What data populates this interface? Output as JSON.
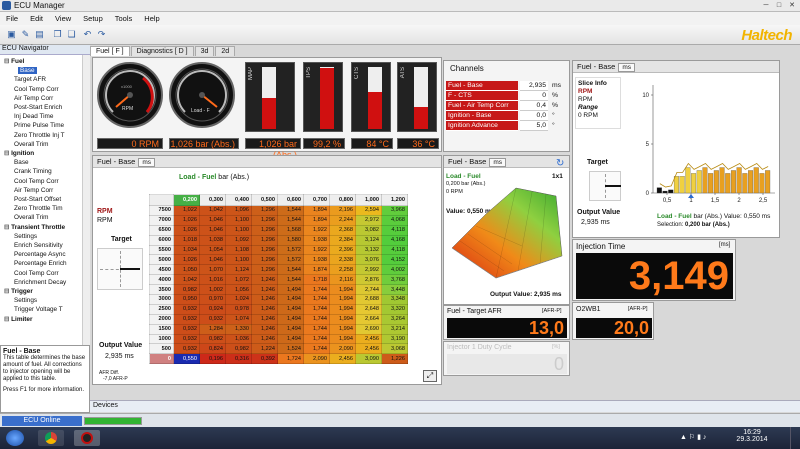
{
  "window": {
    "title": "ECU Manager"
  },
  "menu": [
    "File",
    "Edit",
    "View",
    "Setup",
    "Tools",
    "Help"
  ],
  "brand": "Haltech",
  "nav": {
    "title": "ECU Navigator",
    "items": [
      {
        "label": "Fuel",
        "group": true
      },
      {
        "label": "Base",
        "sel": true
      },
      {
        "label": "Target AFR"
      },
      {
        "label": "Cool Temp Corr"
      },
      {
        "label": "Air Temp Corr"
      },
      {
        "label": "Post-Start Enrich"
      },
      {
        "label": "Inj Dead Time"
      },
      {
        "label": "Prime Pulse Time"
      },
      {
        "label": "Zero Throttle Inj T"
      },
      {
        "label": "Overall Trim"
      },
      {
        "label": "Ignition",
        "group": true
      },
      {
        "label": "Base"
      },
      {
        "label": "Crank Timing"
      },
      {
        "label": "Cool Temp Corr"
      },
      {
        "label": "Air Temp Corr"
      },
      {
        "label": "Post-Start Offset"
      },
      {
        "label": "Zero Throttle Tim"
      },
      {
        "label": "Overall Trim"
      },
      {
        "label": "Transient Throttle",
        "group": true
      },
      {
        "label": "Settings"
      },
      {
        "label": "Enrich Sensitivity"
      },
      {
        "label": "Percentage Async"
      },
      {
        "label": "Percentage Enrich"
      },
      {
        "label": "Cool Temp Corr"
      },
      {
        "label": "Enrichment Decay"
      },
      {
        "label": "Trigger",
        "group": true
      },
      {
        "label": "Settings"
      },
      {
        "label": "Trigger Voltage T"
      },
      {
        "label": "Limiter",
        "group": true
      }
    ]
  },
  "info": {
    "title": "Fuel - Base",
    "text": "This table determines the base amount of fuel. All corrections to injector opening will be applied to this table.",
    "help": "Press F1 for more information."
  },
  "tabs": [
    "Fuel [ F ]",
    "Diagnostics [ D ]",
    "3d",
    "2d"
  ],
  "gauges": {
    "rpm": {
      "label": "RPM",
      "scale": "x1000",
      "value": "0 RPM"
    },
    "load": {
      "label": "Load - F",
      "value": "1,026 bar (Abs.)"
    },
    "map": {
      "label": "MAP",
      "value": "1,026 bar (Abs.)",
      "level": 0.5
    },
    "tps": {
      "label": "TPS",
      "value": "99,2 %",
      "level": 0.99
    },
    "cts": {
      "label": "CTS",
      "value": "84 °C",
      "level": 0.6
    },
    "ats": {
      "label": "ATS",
      "value": "36 °C",
      "level": 0.35
    }
  },
  "channels": {
    "title": "Channels",
    "rows": [
      {
        "name": "Fuel - Base",
        "value": "2,935",
        "unit": "ms"
      },
      {
        "name": "F - CTS",
        "value": "0",
        "unit": "%"
      },
      {
        "name": "Fuel - Air Temp Corr",
        "value": "0,4",
        "unit": "%"
      },
      {
        "name": "Ignition - Base",
        "value": "0,0",
        "unit": "°"
      },
      {
        "name": "Ignition Advance",
        "value": "5,0",
        "unit": "°"
      }
    ]
  },
  "table": {
    "title": "Fuel - Base",
    "unit_btn": "ms",
    "axis_x": "Load - Fuel",
    "axis_x_unit": "bar (Abs.)",
    "axis_y": "RPM",
    "axis_y2": "RPM",
    "target": "Target",
    "output_label": "Output Value",
    "output": "2,935 ms",
    "afr": "AFR Diff.",
    "afr_val": "-7,0 AFR-P",
    "cols": [
      "0,200",
      "0,300",
      "0,400",
      "0,500",
      "0,600",
      "0,700",
      "0,800",
      "1,000",
      "1,200"
    ],
    "rows": [
      {
        "rpm": "7500",
        "v": [
          "1,022",
          "1,042",
          "1,096",
          "1,296",
          "1,544",
          "1,894",
          "2,196",
          "2,594",
          "3,968"
        ]
      },
      {
        "rpm": "7000",
        "v": [
          "1,026",
          "1,046",
          "1,100",
          "1,296",
          "1,544",
          "1,894",
          "2,244",
          "2,972",
          "4,068"
        ]
      },
      {
        "rpm": "6500",
        "v": [
          "1,026",
          "1,046",
          "1,100",
          "1,296",
          "1,568",
          "1,922",
          "2,368",
          "3,082",
          "4,118"
        ]
      },
      {
        "rpm": "6000",
        "v": [
          "1,018",
          "1,038",
          "1,092",
          "1,296",
          "1,580",
          "1,938",
          "2,384",
          "3,124",
          "4,168"
        ]
      },
      {
        "rpm": "5500",
        "v": [
          "1,034",
          "1,054",
          "1,108",
          "1,296",
          "1,572",
          "1,922",
          "2,396",
          "3,132",
          "4,118"
        ]
      },
      {
        "rpm": "5000",
        "v": [
          "1,026",
          "1,046",
          "1,100",
          "1,296",
          "1,572",
          "1,938",
          "2,338",
          "3,076",
          "4,152"
        ]
      },
      {
        "rpm": "4500",
        "v": [
          "1,050",
          "1,070",
          "1,124",
          "1,296",
          "1,544",
          "1,874",
          "2,258",
          "2,992",
          "4,002"
        ]
      },
      {
        "rpm": "4000",
        "v": [
          "1,042",
          "1,016",
          "1,072",
          "1,246",
          "1,544",
          "1,718",
          "2,116",
          "2,876",
          "3,768"
        ]
      },
      {
        "rpm": "3500",
        "v": [
          "0,982",
          "1,002",
          "1,056",
          "1,246",
          "1,494",
          "1,744",
          "1,994",
          "2,744",
          "3,448"
        ]
      },
      {
        "rpm": "3000",
        "v": [
          "0,950",
          "0,970",
          "1,024",
          "1,246",
          "1,494",
          "1,744",
          "1,994",
          "2,688",
          "3,348"
        ]
      },
      {
        "rpm": "2500",
        "v": [
          "0,932",
          "0,924",
          "0,978",
          "1,246",
          "1,494",
          "1,744",
          "1,994",
          "2,648",
          "3,320"
        ]
      },
      {
        "rpm": "2000",
        "v": [
          "0,932",
          "0,932",
          "1,074",
          "1,246",
          "1,494",
          "1,744",
          "1,994",
          "2,664",
          "3,264"
        ]
      },
      {
        "rpm": "1500",
        "v": [
          "0,932",
          "1,284",
          "1,330",
          "1,246",
          "1,494",
          "1,744",
          "1,994",
          "2,690",
          "3,214"
        ]
      },
      {
        "rpm": "1000",
        "v": [
          "0,932",
          "0,982",
          "1,036",
          "1,246",
          "1,494",
          "1,744",
          "1,994",
          "2,456",
          "3,190"
        ]
      },
      {
        "rpm": "500",
        "v": [
          "0,932",
          "0,824",
          "0,982",
          "1,224",
          "1,524",
          "1,744",
          "2,090",
          "2,456",
          "3,068"
        ]
      },
      {
        "rpm": "0",
        "v": [
          "0,550",
          "0,196",
          "0,316",
          "0,392",
          "1,724",
          "2,090",
          "2,456",
          "3,090",
          "1,226"
        ]
      }
    ]
  },
  "view3d": {
    "title": "Fuel - Base",
    "unit_btn": "ms",
    "load_label": "Load - Fuel",
    "load_val": "0,200 bar (Abs.)",
    "rpm_val": "0 RPM",
    "value": "Value: 0,550 ms",
    "output": "Output Value: 2,935 ms",
    "zoom": "1x1"
  },
  "slice": {
    "title": "Fuel - Base",
    "unit_btn": "ms",
    "heading": "Slice Info",
    "rpm_label": "RPM",
    "rpm_label2": "RPM",
    "range": "Range",
    "range_val": "0 RPM",
    "target": "Target",
    "output_label": "Output Value",
    "output": "2,935 ms",
    "foot": "Load - Fuel",
    "foot_unit": "bar (Abs.)",
    "foot_value": "Value: 0,550 ms",
    "selection": "Selection:",
    "selection_val": "0,200 bar (Abs.)",
    "yticks": [
      "10",
      "5",
      "0"
    ],
    "xticks": [
      "0,5",
      "1",
      "1,5",
      "2",
      "2,5"
    ]
  },
  "inj": {
    "title": "Injection Time",
    "unit": "[ms]",
    "value": "3,149"
  },
  "afr": {
    "title": "Fuel - Target AFR",
    "unit": "[AFR-P]",
    "value": "13,0"
  },
  "o2": {
    "title": "O2WB1",
    "unit": "[AFR-P]",
    "value": "20,0"
  },
  "duty": {
    "title": "Injector 1 Duty Cycle",
    "unit": "[%]",
    "value": "0"
  },
  "status": {
    "devices": "Devices",
    "online": "ECU Online"
  },
  "clock": {
    "time": "16:29",
    "date": "29.3.2014"
  }
}
